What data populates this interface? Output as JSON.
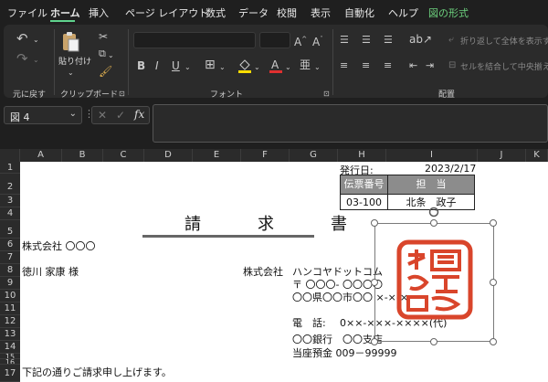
{
  "tabs": [
    "ファイル",
    "ホーム",
    "挿入",
    "ページ レイアウト",
    "数式",
    "データ",
    "校閲",
    "表示",
    "自動化",
    "ヘルプ",
    "図の形式"
  ],
  "ribbon": {
    "groups": {
      "undo": "元に戻す",
      "clipboard": "クリップボード",
      "font": "フォント",
      "alignment": "配置"
    },
    "paste_label": "貼り付け",
    "wrap_text": "折り返して全体を表示す",
    "merge_center": "セルを結合して中央揃え",
    "font_buttons": [
      "B",
      "I",
      "U"
    ]
  },
  "formula_bar": {
    "name_box": "図 4",
    "fx": "fx"
  },
  "columns": [
    "A",
    "B",
    "C",
    "D",
    "E",
    "F",
    "G",
    "H",
    "I",
    "J",
    "K"
  ],
  "rows": [
    "1",
    "2",
    "3",
    "4",
    "5",
    "6",
    "7",
    "8",
    "9",
    "10",
    "11",
    "12",
    "13",
    "14",
    "15",
    "16",
    "17"
  ],
  "sheet": {
    "issue_date_label": "発行日:",
    "issue_date": "2023/2/17",
    "table_headers": [
      "伝票番号",
      "担　当"
    ],
    "table_values": [
      "03-100",
      "北条　政子"
    ],
    "title": "請　求　書",
    "recipient_company": "株式会社 〇〇〇",
    "recipient_person": "徳川 家康 様",
    "sender_company_prefix": "株式会社",
    "sender_company": "ハンコヤドットコム",
    "postal": "〒 〇〇〇- 〇〇〇〇",
    "address": "〇〇県〇〇市〇〇 ×-×-×",
    "phone_label": "電　話:",
    "phone": "0××-×××-××××(代)",
    "bank": "〇〇銀行　〇〇支店",
    "account": "当座預金 009－99999",
    "closing": "下記の通りご請求申し上げます。"
  },
  "stamp": {
    "text": "株式会社 ハンコヤドットコム",
    "color": "#d9452b"
  }
}
